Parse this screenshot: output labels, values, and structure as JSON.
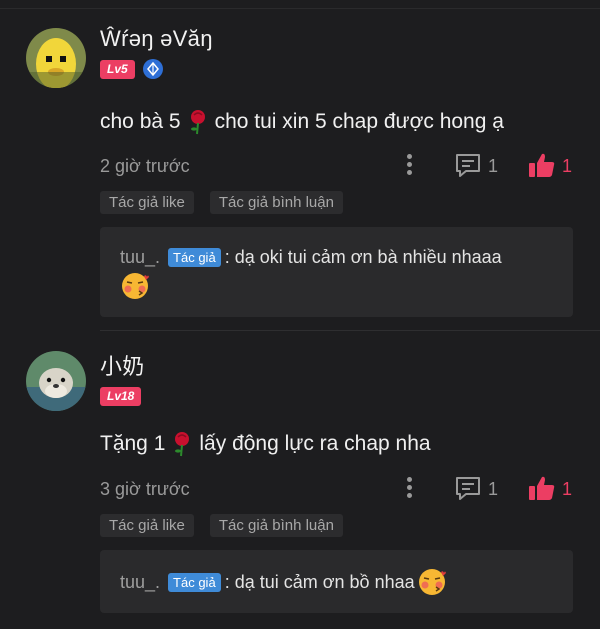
{
  "comments": [
    {
      "username": "Ŵŕəŋ əVăŋ",
      "level": "Lv5",
      "text_before": "cho bà 5",
      "text_after": "cho tui xin 5 chap được hong ạ",
      "time": "2 giờ trước",
      "reply_count": "1",
      "like_count": "1",
      "tags": [
        "Tác giả like",
        "Tác giả bình luận"
      ],
      "reply": {
        "user": "tuu_.",
        "badge": "Tác giả",
        "text": ": dạ oki tui cảm ơn bà nhiều nhaaa"
      }
    },
    {
      "username": "小奶",
      "level": "Lv18",
      "text_before": "Tặng 1",
      "text_after": "lấy động lực ra chap nha",
      "time": "3 giờ trước",
      "reply_count": "1",
      "like_count": "1",
      "tags": [
        "Tác giả like",
        "Tác giả bình luận"
      ],
      "reply": {
        "user": "tuu_.",
        "badge": "Tác giả",
        "text": ": dạ tui cảm ơn bồ nhaa"
      }
    }
  ],
  "colors": {
    "accent": "#ec3e63",
    "author_badge": "#3f8bd8",
    "background": "#1d1d1f"
  },
  "icons": [
    "kebab-menu-icon",
    "comment-icon",
    "thumbs-up-icon",
    "verified-icon",
    "rose-emoji",
    "blushing-kiss-emoji"
  ]
}
